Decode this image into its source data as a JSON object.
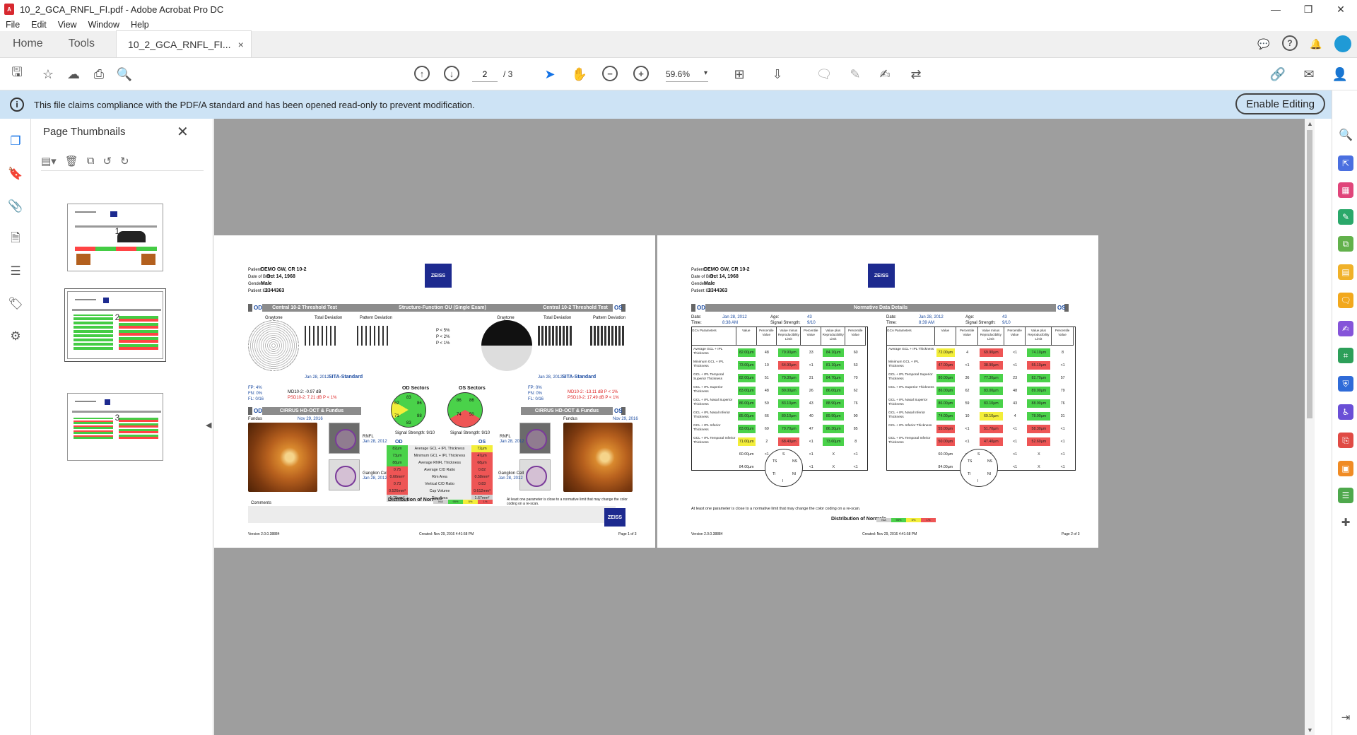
{
  "window": {
    "title": "10_2_GCA_RNFL_FI.pdf - Adobe Acrobat Pro DC",
    "controls": [
      "—",
      "❐",
      "✕"
    ]
  },
  "menu": [
    "File",
    "Edit",
    "View",
    "Window",
    "Help"
  ],
  "tabs": {
    "home": "Home",
    "tools": "Tools",
    "doc": "10_2_GCA_RNFL_FI...",
    "close": "×"
  },
  "toolbar": {
    "page_current": "2",
    "page_total": "/ 3",
    "zoom": "59.6%"
  },
  "infobar": {
    "message": "This file claims compliance with the PDF/A standard and has been opened read-only to prevent modification.",
    "button": "Enable Editing"
  },
  "thumbnails": {
    "title": "Page Thumbnails",
    "pages": [
      "1",
      "2",
      "3"
    ]
  },
  "page_left": {
    "patient_label": "Patient:",
    "patient": "DEMO GW, CR 10-2",
    "dob_label": "Date of Birth:",
    "dob": "Oct 14, 1968",
    "gender_label": "Gender:",
    "gender": "Male",
    "pid_label": "Patient ID:",
    "pid": "3344363",
    "logo": "ZEISS",
    "od": "OD",
    "os": "OS",
    "bar_left": "Central 10-2 Threshold Test",
    "bar_mid": "Structure-Function OU (Single Exam)",
    "bar_right": "Central 10-2 Threshold Test",
    "graytone": "Graytone",
    "total_dev": "Total Deviation",
    "pattern_dev": "Pattern Deviation",
    "legend": [
      "P < 5%",
      "P < 2%",
      "P < 1%"
    ],
    "date_l": "Jan 28, 2012",
    "sita_l": "SITA-Standard",
    "date_r": "Jan 28, 2012",
    "sita_r": "SITA-Standard",
    "fp_l": "FP: 4%",
    "fn_l": "FN: 0%",
    "fl_l": "FL: 0/16",
    "md_l": "MD10-2: -0.97 dB",
    "psd_l": "PSD10-2: 7.21 dB P < 1%",
    "fp_r": "FP: 0%",
    "fn_r": "FN: 0%",
    "fl_r": "FL: 0/16",
    "md_r": "MD10-2: -13.11 dB P < 1%",
    "psd_r": "PSD10-2: 17.49 dB P < 1%",
    "od_sectors": "OD Sectors",
    "os_sectors": "OS Sectors",
    "od_vals": [
      "83",
      "86",
      "62",
      "88",
      "71",
      "83"
    ],
    "os_vals": [
      "86",
      "86",
      "74",
      "50"
    ],
    "signal_l": "Signal Strength: 9/10",
    "signal_r": "Signal Strength: 9/10",
    "cirrus": "CIRRUS HD-OCT & Fundus",
    "fundus": "Fundus",
    "fundus_date": "Nov 29, 2016",
    "rnfl": "RNFL",
    "gc": "Ganglion Cell",
    "scan_date": "Jan 28, 2012",
    "table_od": "OD",
    "table_os": "OS",
    "table": [
      {
        "od": "82µm",
        "label": "Average GCL + IPL Thickness",
        "os": "72µm"
      },
      {
        "od": "73µm",
        "label": "Minimum GCL + IPL Thickness",
        "os": "47µm"
      },
      {
        "od": "88µm",
        "label": "Average RNFL Thickness",
        "os": "68µm"
      },
      {
        "od": "0.75",
        "label": "Average C/D Ratio",
        "os": "0.82"
      },
      {
        "od": "0.60mm²",
        "label": "Rim Area",
        "os": "0.58mm²"
      },
      {
        "od": "0.73",
        "label": "Vertical C/D Ratio",
        "os": "0.83"
      },
      {
        "od": "0.526mm³",
        "label": "Cup Volume",
        "os": "0.612mm³"
      },
      {
        "od": "1.78mm²",
        "label": "Disc Area",
        "os": "1.67mm²"
      }
    ],
    "dist_normals": "Distribution of Normals",
    "dist_values": [
      "N/A",
      "95%",
      "5%",
      "1%"
    ],
    "warning": "At least one parameter is close to a normative limit that may change the color coding on a re-scan.",
    "comments": "Comments",
    "version": "Version 2.0.0.38884",
    "created": "Created: Nov 29, 2016 4:41:58 PM",
    "page": "Page 1 of 3"
  },
  "page_right": {
    "patient_label": "Patient:",
    "patient": "DEMO GW, CR 10-2",
    "dob_label": "Date of Birth:",
    "dob": "Oct 14, 1968",
    "gender_label": "Gender:",
    "gender": "Male",
    "pid_label": "Patient ID:",
    "pid": "3344363",
    "logo": "ZEISS",
    "od": "OD",
    "os": "OS",
    "bar": "Normative Data Details",
    "date_label": "Date:",
    "time_label": "Time:",
    "age_label": "Age:",
    "sig_label": "Signal Strength:",
    "date_l": "Jan 28, 2012",
    "time_l": "8:38 AM",
    "age_l": "43",
    "sig_l": "9/10",
    "date_r": "Jan 28, 2012",
    "time_r": "8:39 AM",
    "age_r": "43",
    "sig_r": "9/10",
    "headers": [
      "GCA Parameters",
      "Value",
      "Percentile Value",
      "Value minus Reproducibility Limit",
      "Percentile Value",
      "Value plus Reproducibility Limit",
      "Percentile Value"
    ],
    "params": [
      "Average GCL + IPL Thickness",
      "Minimum GCL + IPL Thickness",
      "GCL + IPL Temporal Superior Thickness",
      "GCL + IPL Superior Thickness",
      "GCL + IPL Nasal Superior Thickness",
      "GCL + IPL Nasal Inferior Thickness",
      "GCL + IPL Inferior Thickness",
      "GCL + IPL Temporal Inferior Thickness"
    ],
    "od_rows": [
      [
        "82.00µm",
        "48",
        "79.90µm",
        "33",
        "84.10µm",
        "60"
      ],
      [
        "73.00µm",
        "10",
        "64.90µm",
        "<1",
        "81.10µm",
        "53"
      ],
      [
        "82.00µm",
        "51",
        "79.30µm",
        "31",
        "84.70µm",
        "70"
      ],
      [
        "83.00µm",
        "48",
        "80.00µm",
        "26",
        "86.00µm",
        "62"
      ],
      [
        "86.00µm",
        "59",
        "83.10µm",
        "43",
        "88.90µm",
        "76"
      ],
      [
        "85.00µm",
        "66",
        "80.10µm",
        "40",
        "89.90µm",
        "90"
      ],
      [
        "83.00µm",
        "69",
        "79.70µm",
        "47",
        "86.30µm",
        "85"
      ],
      [
        "71.00µm",
        "2",
        "68.40µm",
        "<1",
        "73.60µm",
        "8"
      ]
    ],
    "os_rows": [
      [
        "72.00µm",
        "4",
        "69.90µm",
        "<1",
        "74.10µm",
        "8"
      ],
      [
        "47.00µm",
        "<1",
        "38.90µm",
        "<1",
        "55.10µm",
        "<1"
      ],
      [
        "80.00µm",
        "36",
        "77.30µm",
        "23",
        "82.70µm",
        "57"
      ],
      [
        "86.00µm",
        "62",
        "83.00µm",
        "48",
        "89.00µm",
        "79"
      ],
      [
        "86.00µm",
        "59",
        "83.10µm",
        "43",
        "88.90µm",
        "76"
      ],
      [
        "74.00µm",
        "10",
        "69.10µm",
        "4",
        "78.90µm",
        "31"
      ],
      [
        "55.00µm",
        "<1",
        "51.70µm",
        "<1",
        "58.30µm",
        "<1"
      ],
      [
        "50.00µm",
        "<1",
        "47.40µm",
        "<1",
        "52.60µm",
        "<1"
      ]
    ],
    "extra_od": [
      [
        "60.00µm",
        "<1",
        "X",
        "<1",
        "X",
        "<1"
      ],
      [
        "84.00µm",
        "<1",
        "X",
        "<1",
        "X",
        "<1"
      ]
    ],
    "extra_os": [
      [
        "60.00µm",
        "<1",
        "X",
        "<1",
        "X",
        "<1"
      ],
      [
        "84.00µm",
        "<1",
        "X",
        "<1",
        "X",
        "<1"
      ]
    ],
    "dial_labels": [
      "S",
      "TS",
      "NS",
      "TI",
      "NI",
      "I"
    ],
    "warning": "At least one parameter is close to a normative limit that may change the color coding on a re-scan.",
    "dist_normals": "Distribution of Normals",
    "dist_values": [
      "N/A",
      "95%",
      "5%",
      "1%"
    ],
    "version": "Version 2.0.0.38884",
    "created": "Created: Nov 29, 2016 4:41:58 PM",
    "page": "Page 2 of 3"
  }
}
